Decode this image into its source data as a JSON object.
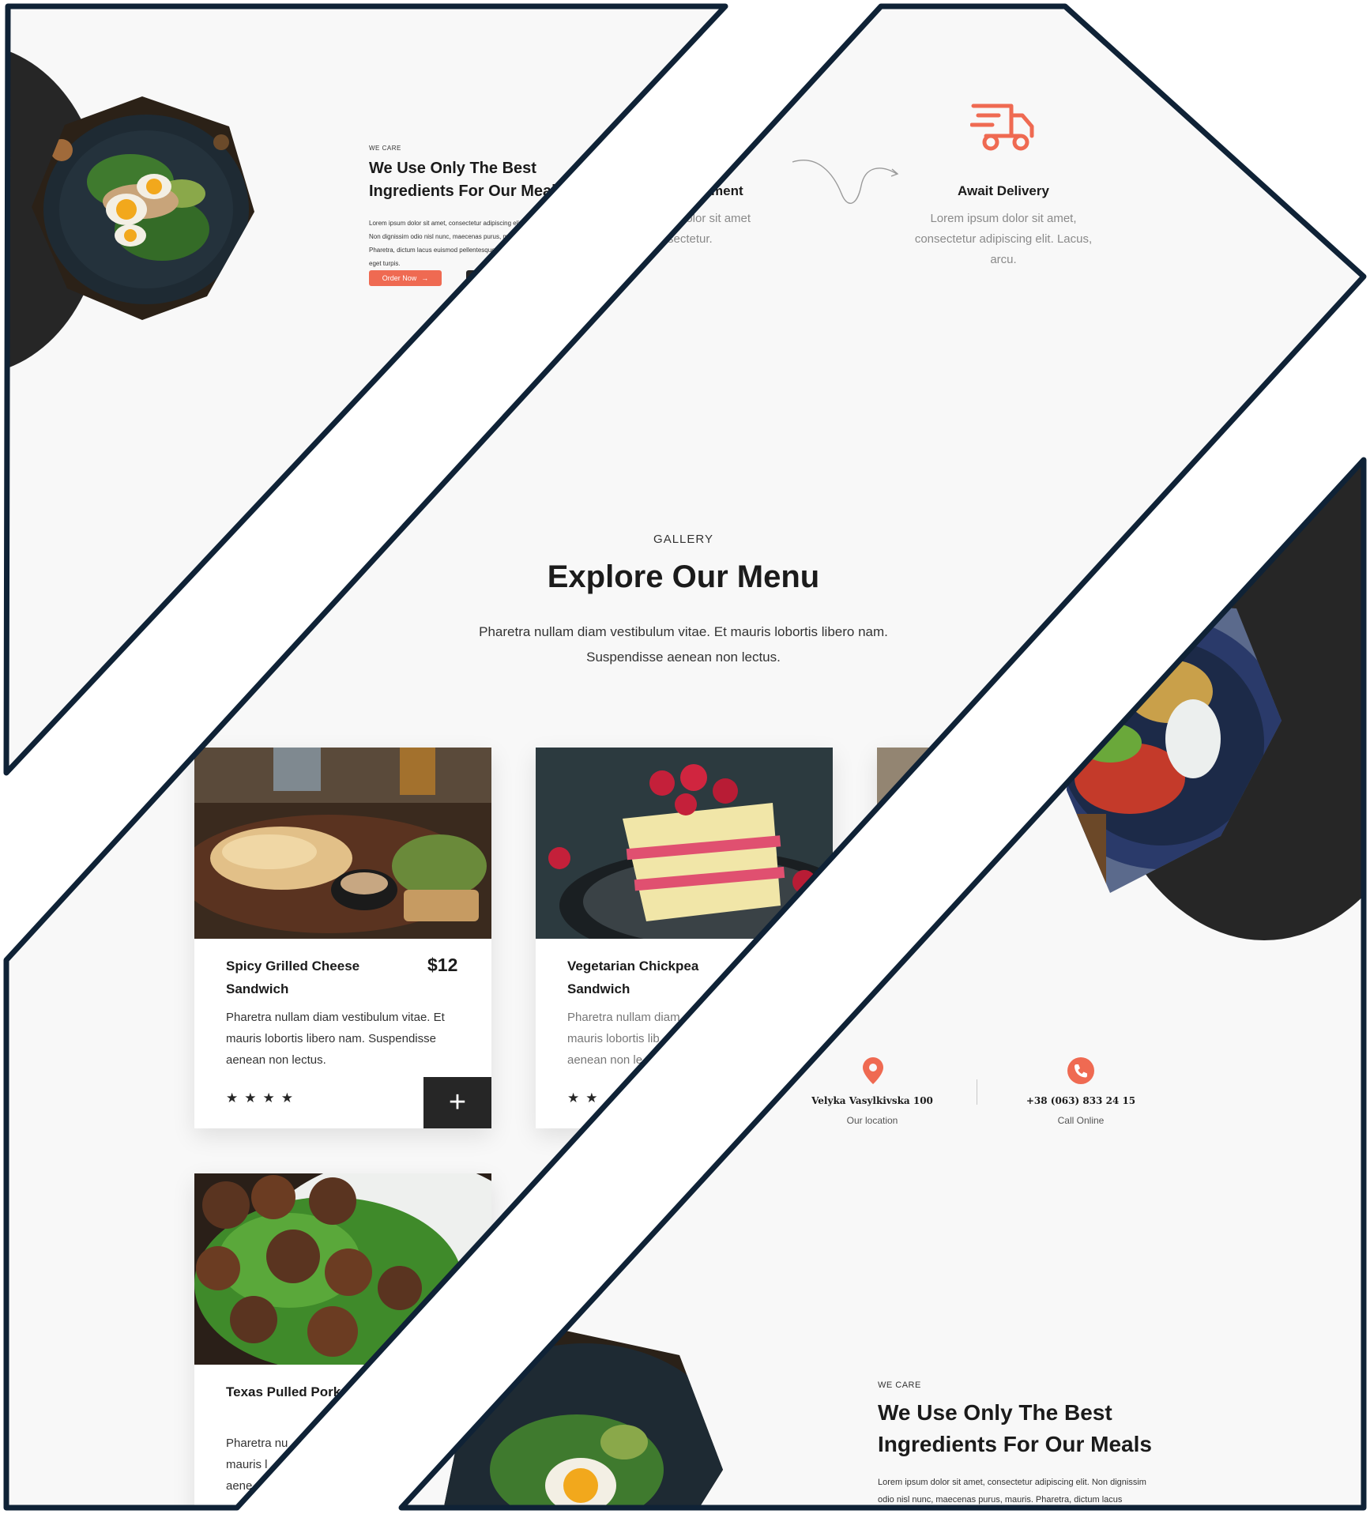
{
  "hero_top": {
    "eyebrow": "WE CARE",
    "title_line1": "We Use Only The Best",
    "title_line2": "Ingredients For Our Meals",
    "body": "Lorem ipsum dolor sit amet, consectetur adipiscing elit. Non dignissim odio nisl nunc, maecenas purus, mauris. Pharetra, dictum lacus euismod pellentesque. Rhoncus eget turpis.",
    "order_button": "Order Now",
    "order_arrow": "→"
  },
  "steps": {
    "payment_title_fragment": "ment",
    "payment_text_line1": "dolor sit amet",
    "payment_text_line2": "sectetur.",
    "delivery_title": "Await Delivery",
    "delivery_text_line1": "Lorem ipsum dolor sit amet,",
    "delivery_text_line2": "consectetur adipiscing elit. Lacus,",
    "delivery_text_line3": "arcu."
  },
  "gallery": {
    "eyebrow": "GALLERY",
    "title": "Explore Our Menu",
    "subtitle_line1": "Pharetra nullam diam vestibulum vitae. Et mauris lobortis libero nam.",
    "subtitle_line2": "Suspendisse aenean non lectus."
  },
  "menu_cards": [
    {
      "name_line1": "Spicy Grilled Cheese",
      "name_line2": "Sandwich",
      "price": "$12",
      "desc_line1": "Pharetra nullam diam vestibulum vitae. Et",
      "desc_line2": "mauris lobortis libero nam. Suspendisse",
      "desc_line3": "aenean non lectus.",
      "stars": "★★★★",
      "add": "+"
    },
    {
      "name_line1": "Vegetarian Chickpea",
      "name_line2": "Sandwich",
      "desc_line1": "Pharetra nullam diam",
      "desc_line2": "mauris lobortis lib",
      "desc_line3": "aenean non le",
      "stars": "★★"
    },
    {
      "name_line1": "Texas Pulled Pork",
      "desc_line1": "Pharetra nu",
      "desc_line2": "mauris l",
      "desc_line3": "aene"
    }
  ],
  "contact": {
    "address": "Velyka Vasylkivska 100",
    "address_label": "Our location",
    "phone": "+38 (063) 833 24 15",
    "phone_label": "Call Online"
  },
  "hero_bottom": {
    "eyebrow": "WE CARE",
    "title_line1": "We Use Only The Best",
    "title_line2": "Ingredients For Our Meals",
    "body_line1": "Lorem ipsum dolor sit amet, consectetur adipiscing elit. Non dignissim",
    "body_line2": "odio nisl nunc, maecenas purus, mauris. Pharetra, dictum lacus"
  },
  "colors": {
    "accent": "#ef6a52",
    "dark": "#262626",
    "frame": "#0f2236",
    "page": "#f8f8f8"
  }
}
